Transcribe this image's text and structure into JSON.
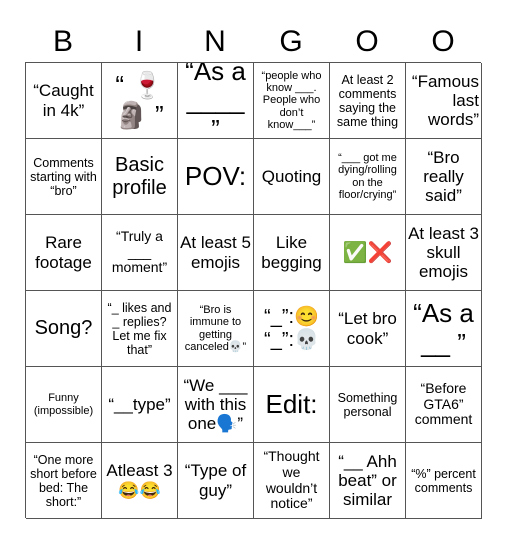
{
  "header": {
    "letters": [
      "B",
      "I",
      "N",
      "G",
      "O",
      "O"
    ]
  },
  "board": {
    "rows": [
      [
        {
          "text": "“Caught in 4k”"
        },
        {
          "text": "“ 🍷 🗿 ”"
        },
        {
          "text": "“As a ____ ”"
        },
        {
          "text": "“people who know ___. People who don’t know___”"
        },
        {
          "text": "At least 2 comments saying the same thing"
        },
        {
          "text": "“Famous last words”"
        }
      ],
      [
        {
          "text": "Comments starting with “bro”"
        },
        {
          "text": "Basic profile"
        },
        {
          "text": "POV:"
        },
        {
          "text": "Quoting"
        },
        {
          "text": "“___ got me dying/rolling on the floor/crying”"
        },
        {
          "text": "“Bro really said”"
        }
      ],
      [
        {
          "text": "Rare footage"
        },
        {
          "text": "“Truly a ___ moment”"
        },
        {
          "text": "At least 5 emojis"
        },
        {
          "text": "Like begging"
        },
        {
          "text": "✅❌"
        },
        {
          "text": "At least 3 skull emojis"
        }
      ],
      [
        {
          "text": "Song?"
        },
        {
          "text": "“_ likes and _ replies? Let me fix that”"
        },
        {
          "text": "“Bro is immune to getting canceled💀”"
        },
        {
          "text": "“_”:😊 “_”:💀"
        },
        {
          "text": "“Let bro cook”"
        },
        {
          "text": "“As a __ ”"
        }
      ],
      [
        {
          "text": "Funny (impossible)"
        },
        {
          "text": "“__type”"
        },
        {
          "text": "“We ___ with this one🗣️”"
        },
        {
          "text": "Edit:"
        },
        {
          "text": "Something personal"
        },
        {
          "text": "“Before GTA6” comment"
        }
      ],
      [
        {
          "text": "“One more short before bed: The short:”"
        },
        {
          "text": "Atleast 3 😂😂"
        },
        {
          "text": "“Type of guy”"
        },
        {
          "text": "“Thought we wouldn’t notice”"
        },
        {
          "text": "“__ Ahh beat” or similar"
        },
        {
          "text": "“%” percent comments"
        }
      ]
    ]
  }
}
